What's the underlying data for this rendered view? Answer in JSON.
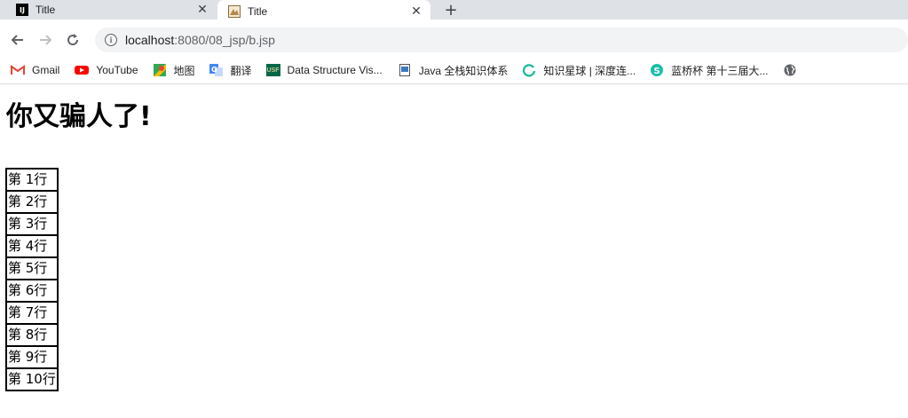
{
  "tabs": [
    {
      "title": "Title",
      "favicon": "intellij-icon",
      "active": false
    },
    {
      "title": "Title",
      "favicon": "jsp-page-icon",
      "active": true
    }
  ],
  "toolbar": {
    "url_host": "localhost",
    "url_path": ":8080/08_jsp/b.jsp"
  },
  "bookmarks": [
    {
      "label": "Gmail",
      "icon": "gmail-icon"
    },
    {
      "label": "YouTube",
      "icon": "youtube-icon"
    },
    {
      "label": "地图",
      "icon": "maps-icon"
    },
    {
      "label": "翻译",
      "icon": "translate-icon"
    },
    {
      "label": "Data Structure Vis...",
      "icon": "usf-icon"
    },
    {
      "label": "Java 全栈知识体系",
      "icon": "java-doc-icon"
    },
    {
      "label": "知识星球 | 深度连...",
      "icon": "zsxq-icon"
    },
    {
      "label": "蓝桥杯 第十三届大...",
      "icon": "lanqiao-icon"
    },
    {
      "label": "",
      "icon": "globe-icon"
    }
  ],
  "page": {
    "heading": "你又骗人了!",
    "rows": [
      "第 1行",
      "第 2行",
      "第 3行",
      "第 4行",
      "第 5行",
      "第 6行",
      "第 7行",
      "第 8行",
      "第 9行",
      "第 10行"
    ]
  },
  "colors": {
    "tabstrip_bg": "#dee1e6",
    "omnibox_bg": "#f1f3f4",
    "youtube_red": "#ff0000",
    "gmail_red": "#ea4335",
    "zsxq_green": "#16b998",
    "lanqiao_teal": "#1dbfa9"
  }
}
